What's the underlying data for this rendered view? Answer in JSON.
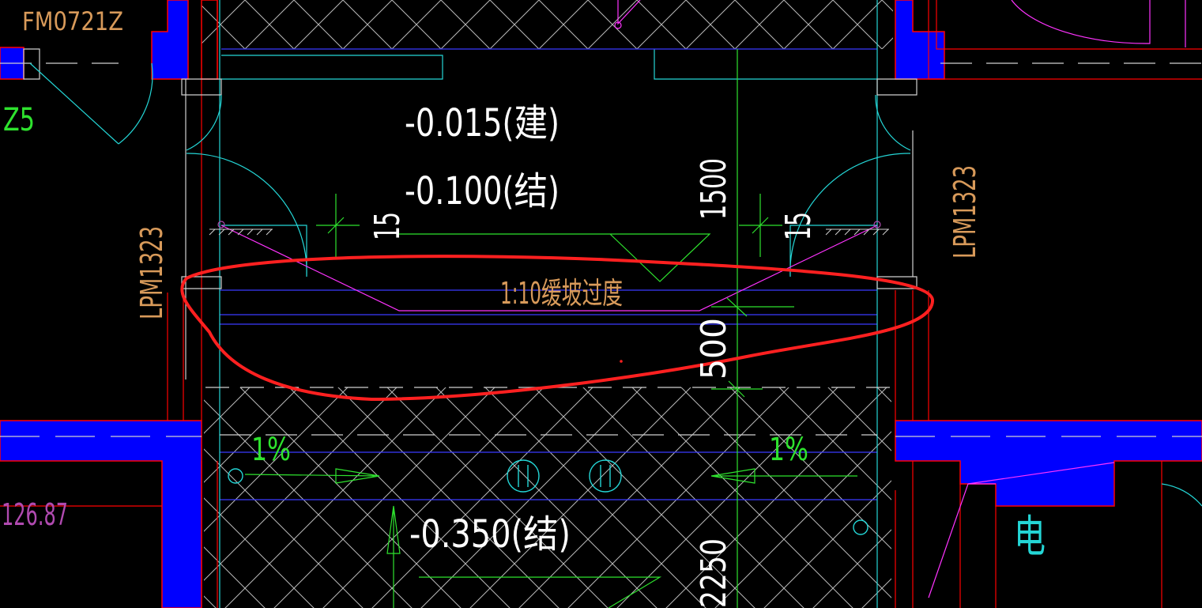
{
  "drawing": {
    "background": "#000000",
    "colors": {
      "wall_fill": "#0000ff",
      "wall_outline": "#ff0000",
      "hatch": "#b9b9b9",
      "door_arc": "#24d6d6",
      "slope_line": "#ff33ff",
      "dimension": "#2ee22e",
      "annotation_circle": "#ff2020",
      "elevation_text": "#ffffff",
      "door_tag": "#d89a5a"
    },
    "labels": {
      "door_top_left": "FM0721Z",
      "z_tag": "Z5",
      "elev_architectural": "-0.015(建)",
      "elev_structural_top": "-0.100(结)",
      "elev_structural_bottom": "-0.350(结)",
      "slope_note": "1:10缓坡过度",
      "door_left": "LPM1323",
      "door_right": "LPM1323",
      "dim_1500": "1500",
      "dim_500": "500",
      "dim_2250": "2250",
      "dim_15_left": "15",
      "dim_15_right": "15",
      "slope_pct_left": "1%",
      "slope_pct_right": "1%",
      "area_value": "126.87",
      "room_electric": "电"
    }
  }
}
